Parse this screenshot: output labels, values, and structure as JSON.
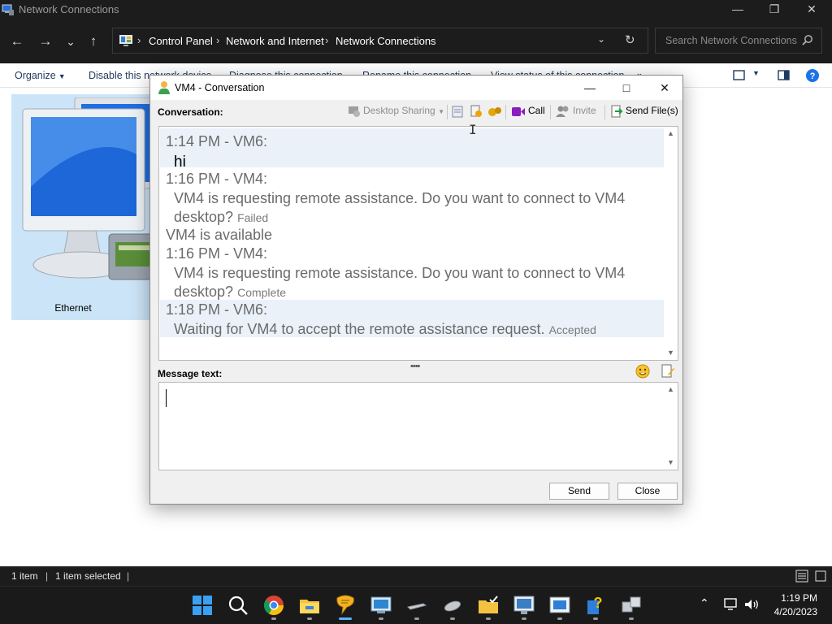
{
  "explorer": {
    "title": "Network Connections",
    "controls": {
      "minimize": "—",
      "maximize": "❐",
      "close": "✕"
    },
    "nav": {
      "back": "←",
      "forward": "→",
      "recent": "⌄",
      "up": "↑"
    },
    "breadcrumb": [
      "Control Panel",
      "Network and Internet",
      "Network Connections"
    ],
    "breadcrumb_sep": "›",
    "search_placeholder": "Search Network Connections",
    "commands": {
      "organize": "Organize",
      "disable": "Disable this network device",
      "diagnose": "Diagnose this connection",
      "rename": "Rename this connection",
      "view_status": "View status of this connection",
      "more": "»"
    },
    "items": [
      {
        "label": "Ethernet",
        "icon": "network-adapter-icon"
      }
    ],
    "status": {
      "count": "1 item",
      "selected": "1 item selected",
      "sep": "|"
    }
  },
  "dialog": {
    "title": "VM4 - Conversation",
    "conversation_label": "Conversation:",
    "toolbar": {
      "desktop_sharing": "Desktop Sharing",
      "call": "Call",
      "invite": "Invite",
      "send_files": "Send File(s)"
    },
    "messages": [
      {
        "header": "1:14 PM - VM6:",
        "body": "hi"
      },
      {
        "header": "1:16 PM - VM4:",
        "body": "VM4 is requesting remote assistance. Do you want to connect to VM4 desktop?",
        "status": "Failed"
      },
      {
        "line": "VM4 is available"
      },
      {
        "header": "1:16 PM - VM4:",
        "body": "VM4 is requesting remote assistance. Do you want to connect to VM4 desktop?",
        "status": "Complete"
      },
      {
        "header": "1:18 PM - VM6:",
        "body": "Waiting for VM4 to accept the remote assistance request.",
        "status": "Accepted"
      }
    ],
    "message_text_label": "Message text:",
    "message_value": "",
    "buttons": {
      "send": "Send",
      "close": "Close"
    }
  },
  "taskbar": {
    "apps": [
      "start-icon",
      "search-icon",
      "chrome-icon",
      "file-explorer-icon",
      "messenger-icon",
      "remote-desktop-icon",
      "network-icon",
      "mouse-icon",
      "folder-check-icon",
      "monitor-icon",
      "window-app-icon",
      "help-icon",
      "network-computers-icon"
    ],
    "time": "1:19 PM",
    "date": "4/20/2023"
  },
  "colors": {
    "dark_chrome": "#1c1c1c",
    "selection": "#cce4f7",
    "accent": "#0078d4",
    "call_purple": "#8a1cc0",
    "message_shading": "#eaf1f9"
  }
}
